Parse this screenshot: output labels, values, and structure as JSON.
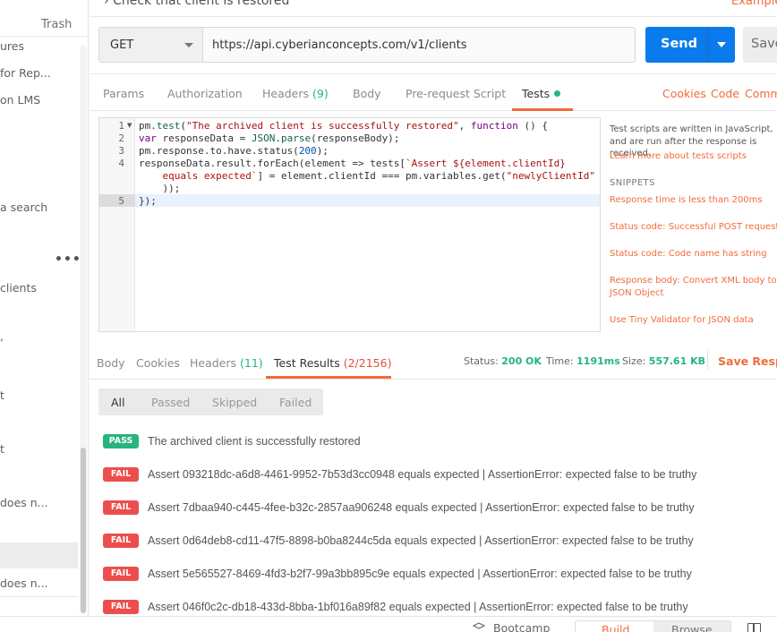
{
  "sidebar": {
    "trash_label": "Trash",
    "items": [
      {
        "label": "ures"
      },
      {
        "label": " for Rep..."
      },
      {
        "label": "on LMS"
      },
      {
        "label": "a search"
      },
      {
        "label": "clients"
      },
      {
        "label": ","
      },
      {
        "label": "t"
      },
      {
        "label": "t"
      },
      {
        "label": " does n..."
      },
      {
        "label": " does n..."
      }
    ],
    "more_label": "•••"
  },
  "top": {
    "title": "Check that client is restored",
    "examples_label": "Examples"
  },
  "request": {
    "method": "GET",
    "url": "https://api.cyberianconcepts.com/v1/clients",
    "send_label": "Send",
    "save_label": "Save"
  },
  "request_tabs": {
    "params": "Params",
    "authorization": "Authorization",
    "headers": "Headers",
    "headers_count": "(9)",
    "body": "Body",
    "prerequest": "Pre-request Script",
    "tests": "Tests",
    "cookies": "Cookies",
    "code": "Code",
    "comments": "Comments"
  },
  "editor": {
    "line_numbers": [
      "1",
      "2",
      "3",
      "4",
      "5"
    ]
  },
  "snippets_panel": {
    "help_text": "Test scripts are written in JavaScript, and are run after the response is received.",
    "learn_link": "Learn more about tests scripts",
    "title": "SNIPPETS",
    "items": [
      "Response time is less than 200ms",
      "Status code: Successful POST request",
      "Status code: Code name has string",
      "Response body: Convert XML body to a JSON Object",
      "Use Tiny Validator for JSON data"
    ]
  },
  "response_tabs": {
    "body": "Body",
    "cookies": "Cookies",
    "headers": "Headers",
    "headers_count": "(11)",
    "test_results": "Test Results",
    "test_results_count": "(2/2156)"
  },
  "response_meta": {
    "status_label": "Status:",
    "status_value": "200 OK",
    "time_label": "Time:",
    "time_value": "1191ms",
    "size_label": "Size:",
    "size_value": "557.61 KB",
    "save_response": "Save Response"
  },
  "filters": {
    "all": "All",
    "passed": "Passed",
    "skipped": "Skipped",
    "failed": "Failed"
  },
  "results": [
    {
      "status": "PASS",
      "text": "The archived client is successfully restored"
    },
    {
      "status": "FAIL",
      "text": "Assert 093218dc-a6d8-4461-9952-7b53d3cc0948 equals expected | AssertionError: expected false to be truthy"
    },
    {
      "status": "FAIL",
      "text": "Assert 7dbaa940-c445-4fee-b32c-2857aa906248 equals expected | AssertionError: expected false to be truthy"
    },
    {
      "status": "FAIL",
      "text": "Assert 0d64deb8-cd11-47f5-8898-b0ba8244c5da equals expected | AssertionError: expected false to be truthy"
    },
    {
      "status": "FAIL",
      "text": "Assert 5e565527-8469-4fd3-b2f7-99a3bb895c9e equals expected | AssertionError: expected false to be truthy"
    },
    {
      "status": "FAIL",
      "text": "Assert 046f0c2c-db18-433d-8bba-1bf016a89f82 equals expected | AssertionError: expected false to be truthy"
    }
  ],
  "footer": {
    "bootcamp": "Bootcamp",
    "build": "Build",
    "browse": "Browse"
  }
}
